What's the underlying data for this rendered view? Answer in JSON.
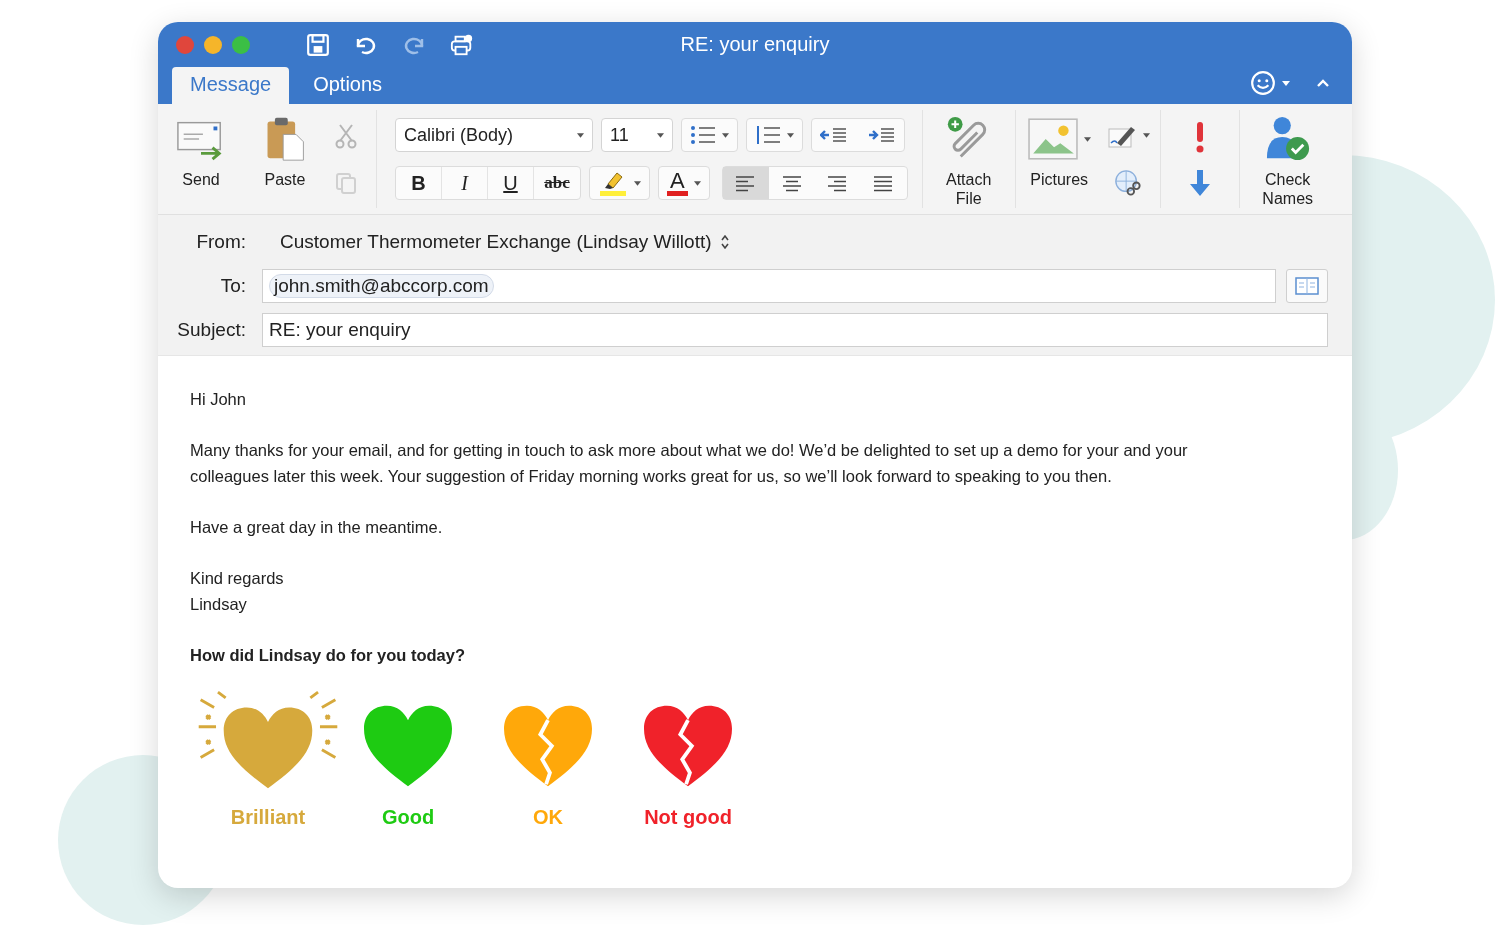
{
  "window": {
    "title": "RE: your enquiry"
  },
  "tabs": [
    {
      "label": "Message",
      "selected": true
    },
    {
      "label": "Options",
      "selected": false
    }
  ],
  "ribbon": {
    "send": "Send",
    "paste": "Paste",
    "font": "Calibri (Body)",
    "size": "11",
    "format_buttons": [
      {
        "label": "B",
        "kind": "bold"
      },
      {
        "label": "I",
        "kind": "italic"
      },
      {
        "label": "U",
        "kind": "underline"
      },
      {
        "label": "abc",
        "kind": "strike"
      }
    ],
    "font_color": "A",
    "alignment": [
      {
        "kind": "left",
        "selected": true
      },
      {
        "kind": "center",
        "selected": false
      },
      {
        "kind": "right",
        "selected": false
      },
      {
        "kind": "justify",
        "selected": false
      }
    ],
    "attach": "Attach File",
    "pictures": "Pictures",
    "check_names": "Check Names"
  },
  "header": {
    "from_label": "From:",
    "from_value": "Customer Thermometer Exchange (Lindsay Willott)",
    "to_label": "To:",
    "to_recipient": "john.smith@abccorp.com",
    "subject_label": "Subject:",
    "subject_value": "RE: your enquiry"
  },
  "body": {
    "greeting": "Hi John",
    "paragraphs": [
      "Many thanks for your email, and for getting in touch to ask more about what we do! We’d be delighted to set up a demo for your and your colleagues later this week. Your suggestion of Friday morning works great for us, so we’ll look forward to speaking to you then.",
      "Have a great day in the meantime."
    ],
    "closing": [
      "Kind regards",
      "Lindsay"
    ],
    "question": "How did Lindsay do for you today?",
    "ratings": [
      {
        "label": "Brilliant",
        "kind": "sparkle",
        "color": "#d6a93c"
      },
      {
        "label": "Good",
        "kind": "whole",
        "color": "#1ecb12"
      },
      {
        "label": "OK",
        "kind": "broken",
        "color": "#ffa80a"
      },
      {
        "label": "Not good",
        "kind": "broken",
        "color": "#f0222a"
      }
    ]
  }
}
